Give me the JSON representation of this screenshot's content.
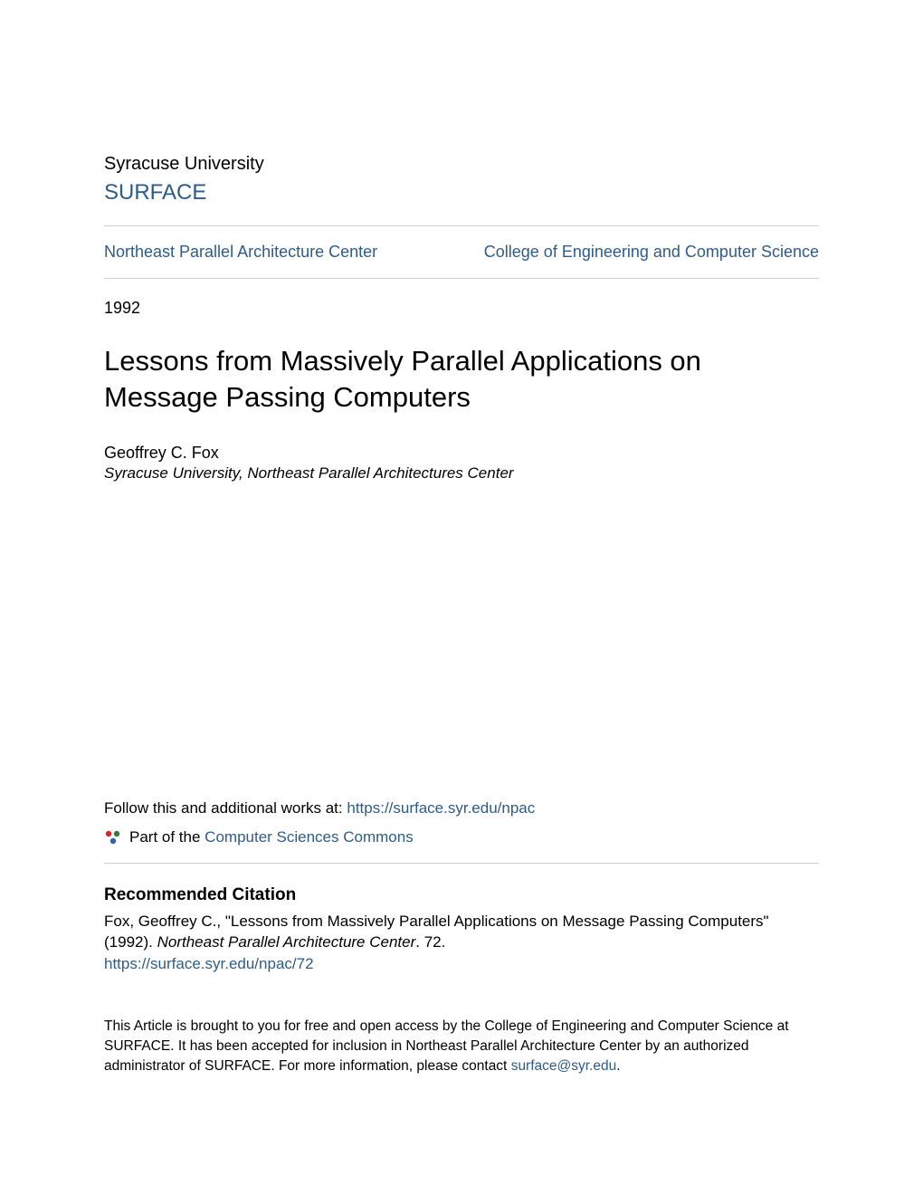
{
  "header": {
    "university": "Syracuse University",
    "repository": "SURFACE"
  },
  "nav": {
    "left": "Northeast Parallel Architecture Center",
    "right": "College of Engineering and Computer Science"
  },
  "year": "1992",
  "title": "Lessons from Massively Parallel Applications on Message Passing Computers",
  "author": {
    "name": "Geoffrey C. Fox",
    "affiliation": "Syracuse University, Northeast Parallel Architectures Center"
  },
  "follow": {
    "prefix": "Follow this and additional works at: ",
    "link": "https://surface.syr.edu/npac"
  },
  "network": {
    "prefix": "Part of the ",
    "link": "Computer Sciences Commons"
  },
  "citation": {
    "heading": "Recommended Citation",
    "text_part1": "Fox, Geoffrey C., \"Lessons from Massively Parallel Applications on Message Passing Computers\" (1992). ",
    "journal": "Northeast Parallel Architecture Center",
    "text_part2": ". 72.",
    "link": "https://surface.syr.edu/npac/72"
  },
  "footer": {
    "text": "This Article is brought to you for free and open access by the College of Engineering and Computer Science at SURFACE. It has been accepted for inclusion in Northeast Parallel Architecture Center by an authorized administrator of SURFACE. For more information, please contact ",
    "email": "surface@syr.edu",
    "period": "."
  }
}
